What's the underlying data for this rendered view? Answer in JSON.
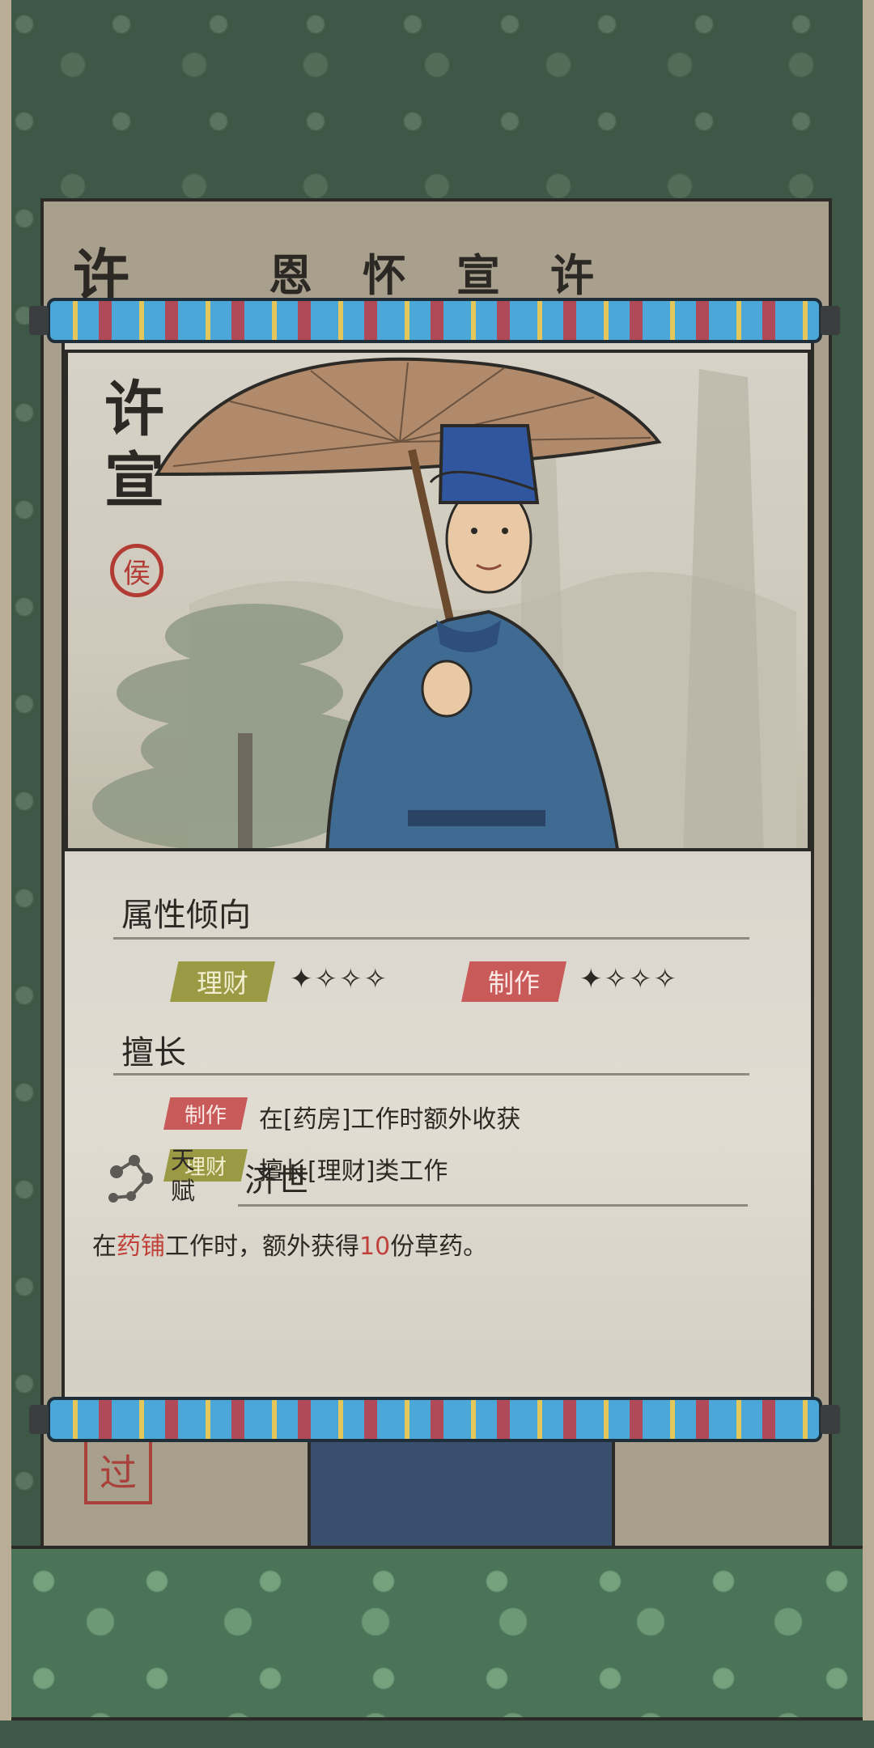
{
  "back_card": {
    "title_chars": [
      "许",
      "恩",
      "怀",
      "宣",
      "许"
    ],
    "stamp": "过"
  },
  "portrait": {
    "name_line1": "许",
    "name_line2": "宣",
    "seal": "侯"
  },
  "attributes": {
    "title": "属性倾向",
    "items": [
      {
        "label": "理财",
        "stars": "✦✧✧✧",
        "rating": 1
      },
      {
        "label": "制作",
        "stars": "✦✧✧✧",
        "rating": 1
      }
    ]
  },
  "skills": {
    "title": "擅长",
    "items": [
      {
        "tag": "制作",
        "text": "在[药房]工作时额外收获"
      },
      {
        "tag": "理财",
        "text": "擅长[理财]类工作"
      }
    ]
  },
  "talent": {
    "label_top": "天",
    "label_bottom": "赋",
    "name": "济世",
    "desc_prefix": "在",
    "desc_hl1": "药铺",
    "desc_mid": "工作时，额外获得",
    "desc_hl2": "10",
    "desc_suffix": "份草药。"
  },
  "colors": {
    "finance_tag": "#9a9a45",
    "craft_tag": "#c85a5a",
    "highlight": "#c0403a",
    "frame_green": "#3d5846"
  }
}
